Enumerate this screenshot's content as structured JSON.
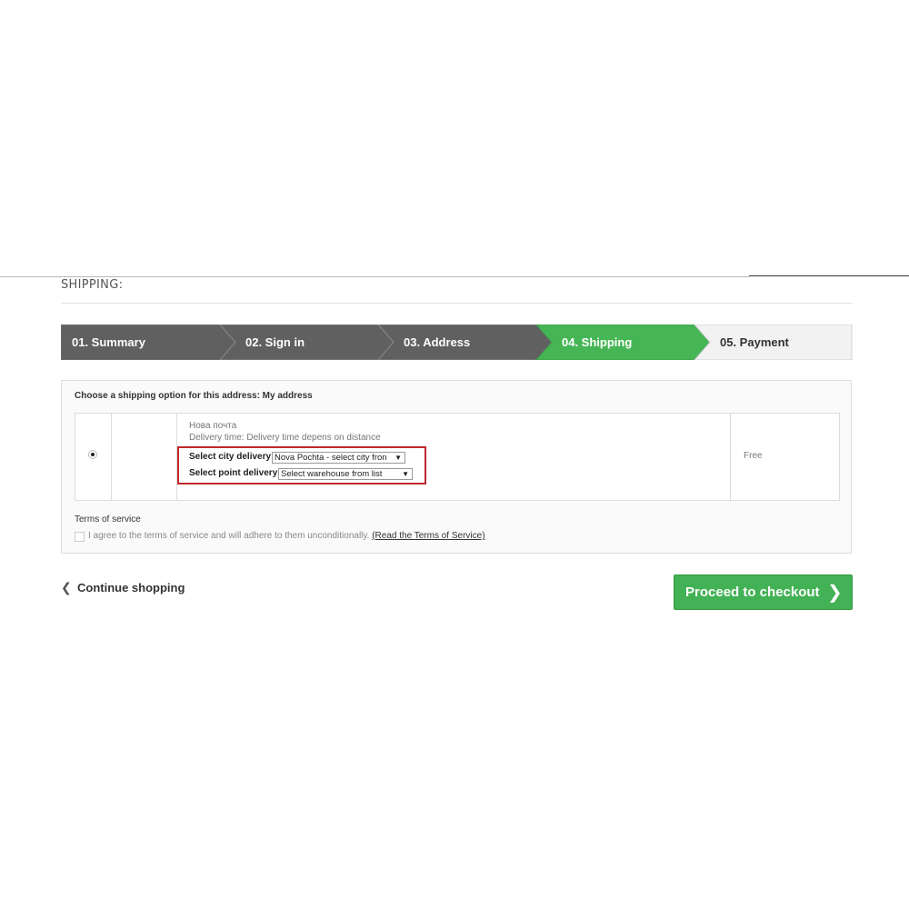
{
  "page_heading": "SHIPPING:",
  "steps": [
    {
      "label": "01. Summary",
      "state": "done"
    },
    {
      "label": "02. Sign in",
      "state": "done"
    },
    {
      "label": "03. Address",
      "state": "done"
    },
    {
      "label": "04. Shipping",
      "state": "current"
    },
    {
      "label": "05. Payment",
      "state": "todo"
    }
  ],
  "colors": {
    "done": "#606060",
    "current": "#46b555",
    "todo": "#f2f2f2",
    "highlight": "#c0272d"
  },
  "shipping": {
    "choose_label": "Choose a shipping option for this address: My address",
    "carrier": {
      "name": "Нова почта",
      "delay": "Delivery time: Delivery time depens on distance",
      "price": "Free",
      "city_label": "Select city delivery:",
      "city_value": "Nova Pochta - select city fron",
      "point_label": "Select point delivery:",
      "point_value": "Select warehouse from list"
    }
  },
  "terms": {
    "title": "Terms of service",
    "agree_text": "I agree to the terms of service and will adhere to them unconditionally.",
    "link_text": "(Read the Terms of Service)"
  },
  "actions": {
    "continue": "Continue shopping",
    "checkout": "Proceed to checkout"
  }
}
